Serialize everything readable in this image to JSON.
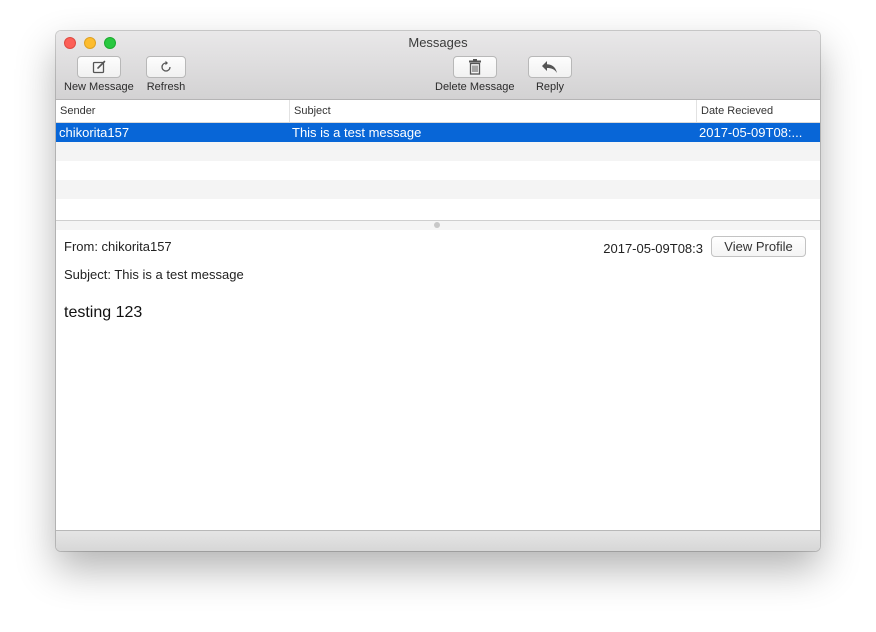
{
  "window": {
    "title": "Messages",
    "traffic_lights": {
      "close": "#fc5f57",
      "minimize": "#fdbc2e",
      "zoom": "#29c840"
    }
  },
  "toolbar": {
    "new_message": {
      "label": "New Message",
      "icon": "compose-icon"
    },
    "refresh": {
      "label": "Refresh",
      "icon": "refresh-icon"
    },
    "delete_message": {
      "label": "Delete Message",
      "icon": "trash-icon"
    },
    "reply": {
      "label": "Reply",
      "icon": "reply-arrow-icon"
    }
  },
  "table": {
    "columns": [
      "Sender",
      "Subject",
      "Date Recieved"
    ],
    "rows": [
      {
        "sender": "chikorita157",
        "subject": "This is a test message",
        "date": "2017-05-09T08:...",
        "selected": true
      }
    ],
    "selection_color": "#0866d7"
  },
  "detail": {
    "from": "From: chikorita157",
    "date": "2017-05-09T08:3",
    "view_profile": "View Profile",
    "subject": "Subject: This is a test message",
    "body": "testing 123"
  }
}
